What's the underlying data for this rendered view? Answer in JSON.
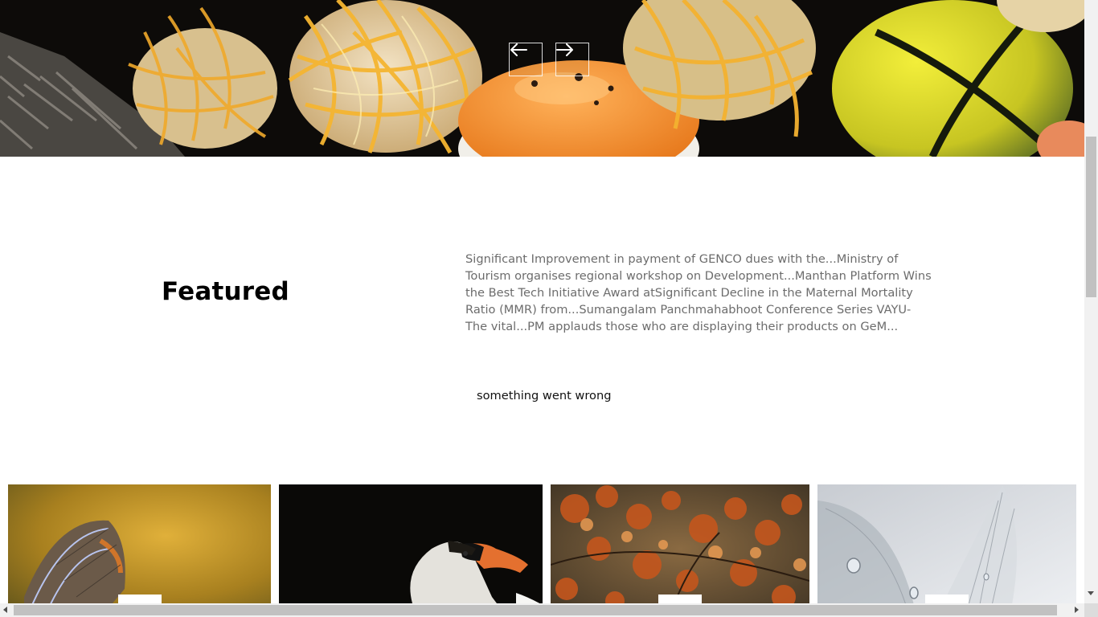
{
  "hero": {
    "prev_icon": "arrow-left-icon",
    "next_icon": "arrow-right-icon"
  },
  "featured": {
    "title": "Featured",
    "text": "Significant Improvement in payment of GENCO dues with the...Ministry of Tourism organises regional workshop on Development...Manthan Platform Wins the Best Tech Initiative Award atSignificant Decline in the Maternal Mortality Ratio (MMR) from...Sumangalam Panchmahabhoot Conference Series VAYU- The vital...PM applauds those who are displaying their products on GeM...",
    "error": "something went wrong"
  },
  "colors": {
    "page_background": "#ffffff",
    "title_text": "#000000",
    "body_text": "#6c6c6c",
    "scrollbar_track": "#f1f1f1",
    "scrollbar_thumb": "#c1c1c1"
  }
}
